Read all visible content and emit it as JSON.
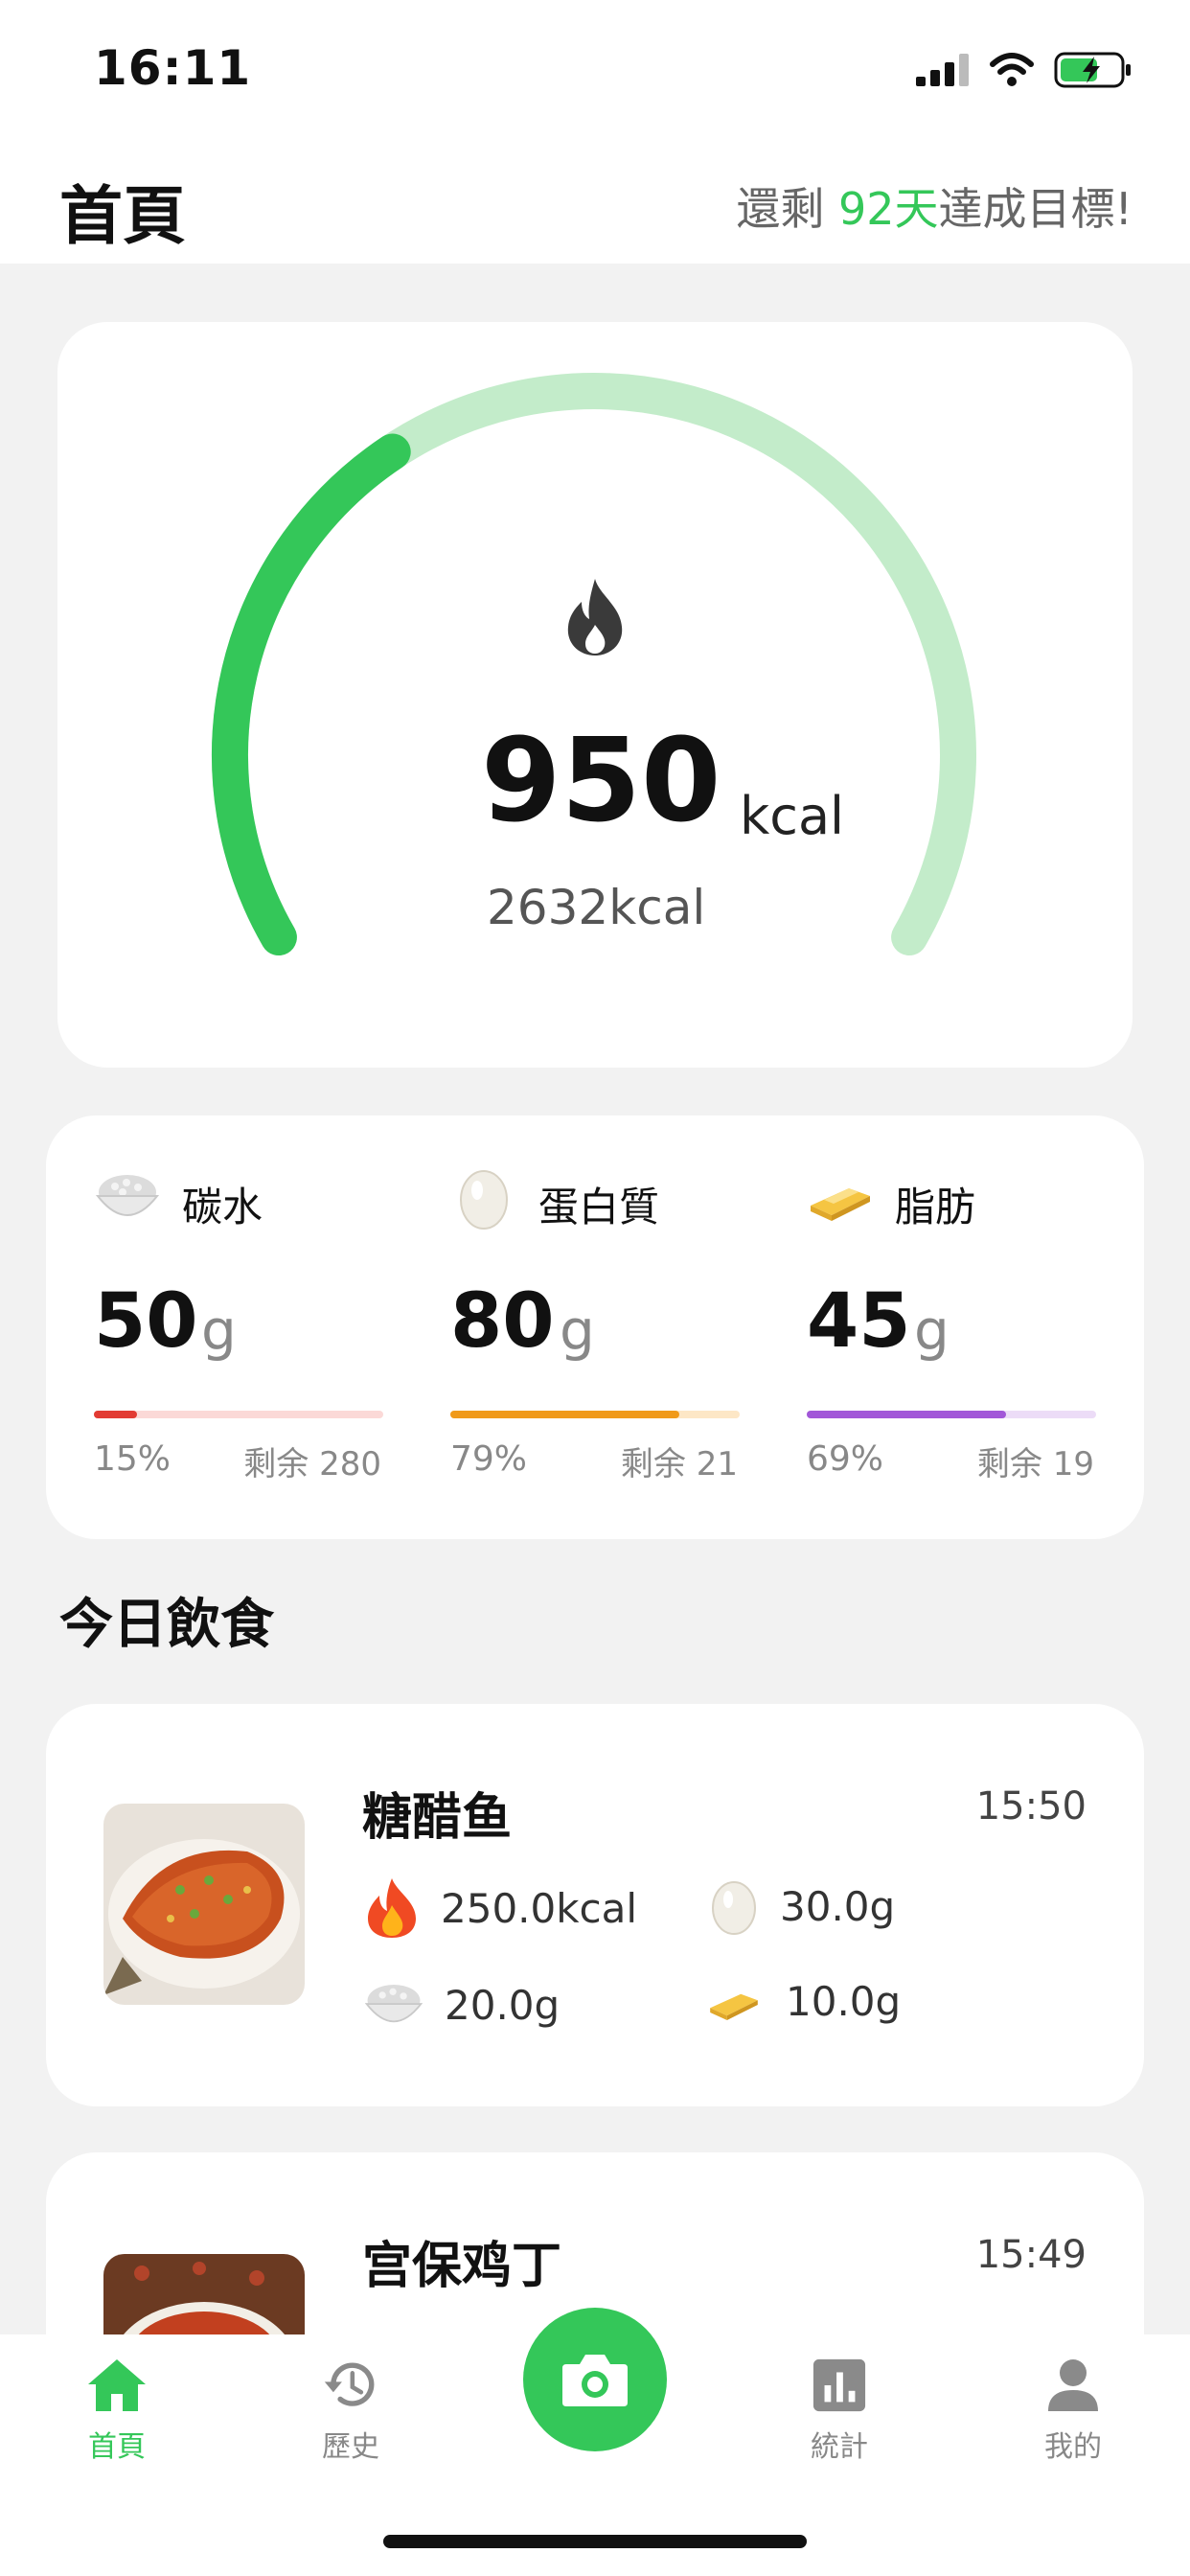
{
  "status_bar": {
    "time": "16:11"
  },
  "header": {
    "title": "首頁",
    "goal_prefix": "還剩 ",
    "goal_days": "92",
    "goal_days_unit": "天",
    "goal_suffix": "達成目標!"
  },
  "calories": {
    "consumed": "950",
    "unit": "kcal",
    "target_text": "2632kcal",
    "progress_fraction": 0.36
  },
  "macros": [
    {
      "name": "碳水",
      "value": "50",
      "unit": "g",
      "percent": "15%",
      "remaining": "剩余 280",
      "fill": 0.15,
      "color": "#e23b33",
      "track": "#fbd9d7"
    },
    {
      "name": "蛋白質",
      "value": "80",
      "unit": "g",
      "percent": "79%",
      "remaining": "剩余 21",
      "fill": 0.79,
      "color": "#f09a1a",
      "track": "#fde7c6"
    },
    {
      "name": "脂肪",
      "value": "45",
      "unit": "g",
      "percent": "69%",
      "remaining": "剩余 19",
      "fill": 0.69,
      "color": "#a257d8",
      "track": "#ecdcf7"
    }
  ],
  "today": {
    "title": "今日飲食",
    "meals": [
      {
        "name": "糖醋鱼",
        "time": "15:50",
        "kcal": "250.0kcal",
        "protein": "30.0g",
        "carbs": "20.0g",
        "fat": "10.0g"
      },
      {
        "name": "宫保鸡丁",
        "time": "15:49"
      }
    ]
  },
  "tabbar": {
    "home": "首頁",
    "history": "歷史",
    "stats": "統計",
    "me": "我的"
  },
  "colors": {
    "accent": "#34c759",
    "accent_light": "#c3ecca"
  }
}
